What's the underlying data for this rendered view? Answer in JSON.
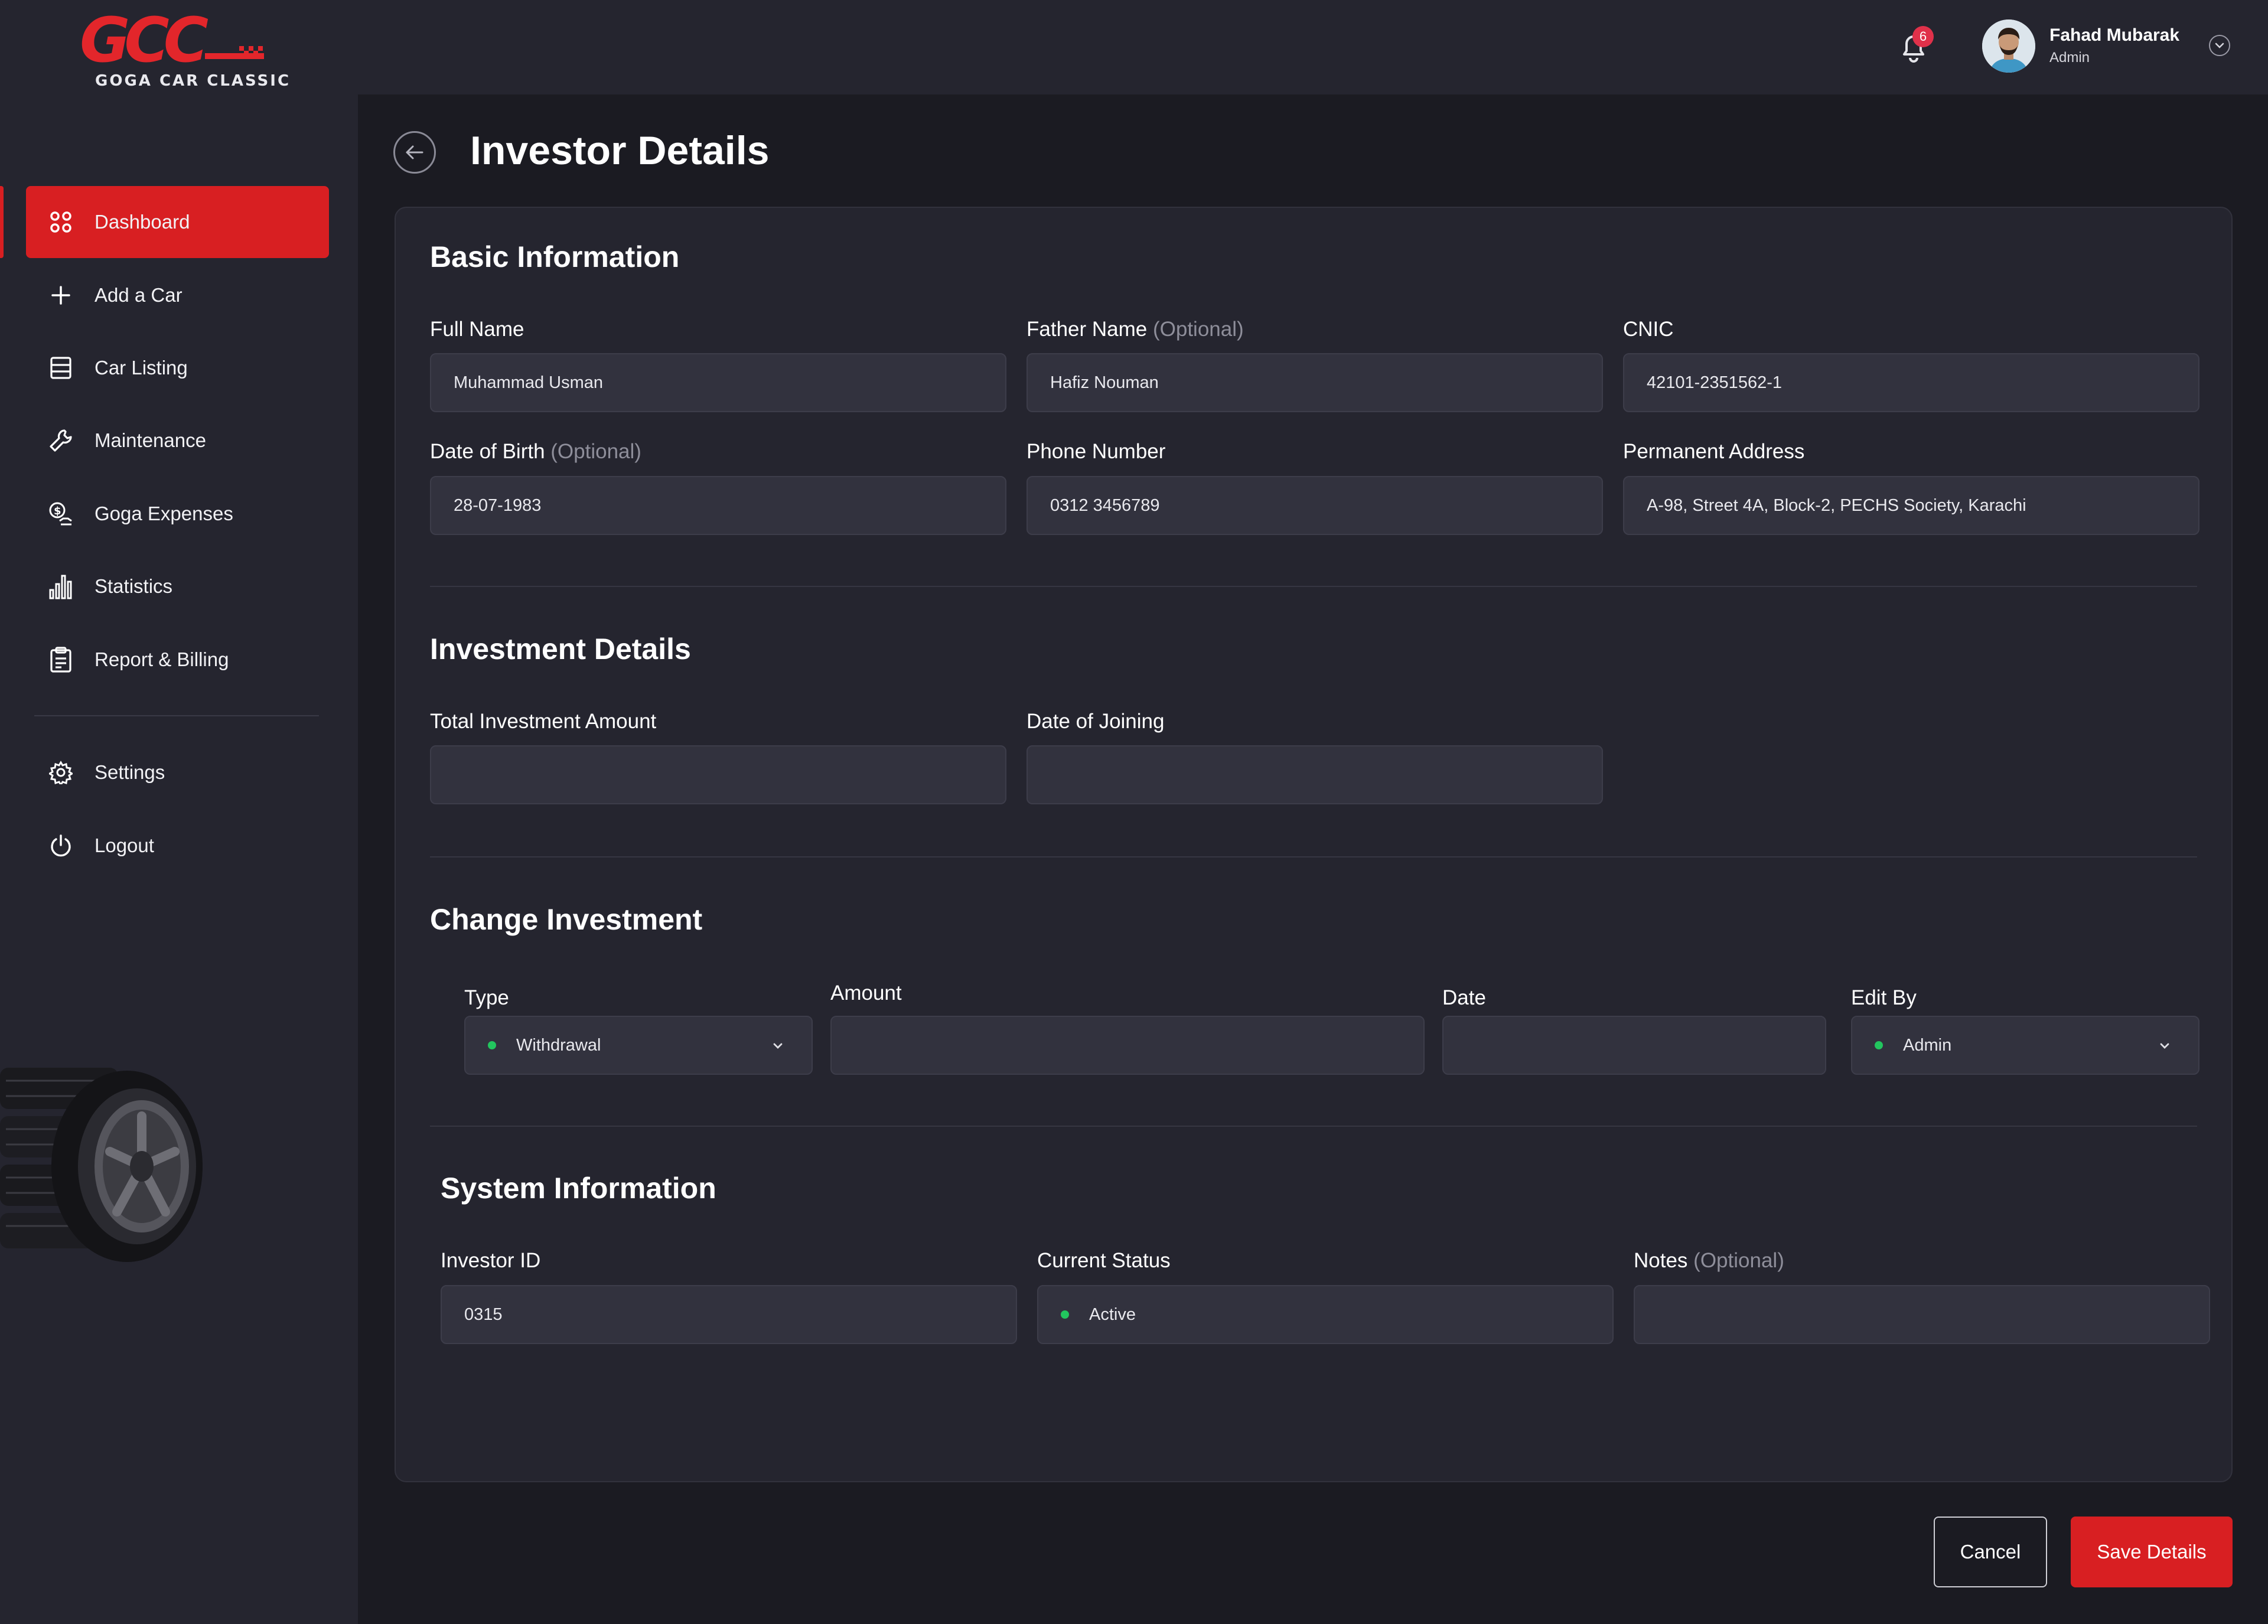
{
  "brand": {
    "logo_text": "GCC",
    "logo_subtitle": "Goga Car Classic",
    "accent_color": "#d81f22"
  },
  "sidebar": {
    "items": [
      {
        "label": "Dashboard",
        "icon": "grid-icon",
        "active": true
      },
      {
        "label": "Add a Car",
        "icon": "plus-icon",
        "active": false
      },
      {
        "label": "Car Listing",
        "icon": "list-icon",
        "active": false
      },
      {
        "label": "Maintenance",
        "icon": "wrench-icon",
        "active": false
      },
      {
        "label": "Goga Expenses",
        "icon": "money-hand-icon",
        "active": false
      },
      {
        "label": "Statistics",
        "icon": "bar-chart-icon",
        "active": false
      },
      {
        "label": "Report & Billing",
        "icon": "clipboard-icon",
        "active": false
      },
      {
        "label": "Settings",
        "icon": "gear-icon",
        "active": false
      },
      {
        "label": "Logout",
        "icon": "power-icon",
        "active": false
      }
    ]
  },
  "header": {
    "notification_count": "6",
    "user_name": "Fahad Mubarak",
    "user_role": "Admin"
  },
  "page": {
    "title": "Investor Details"
  },
  "basic_info": {
    "title": "Basic Information",
    "full_name_label": "Full Name",
    "full_name": "Muhammad Usman",
    "father_name_label": "Father Name",
    "father_name": "Hafiz Nouman",
    "cnic_label": "CNIC",
    "cnic": "42101-2351562-1",
    "dob_label": "Date of Birth",
    "dob": "28-07-1983",
    "phone_label": "Phone Number",
    "phone": "0312 3456789",
    "address_label": "Permanent Address",
    "address": "A-98, Street 4A, Block-2, PECHS Society, Karachi",
    "optional_text": "(Optional)"
  },
  "investment": {
    "title": "Investment Details",
    "total_label": "Total Investment Amount",
    "total_value": "",
    "joining_label": "Date of Joining",
    "joining_value": ""
  },
  "change_investment": {
    "title": "Change Investment",
    "type_label": "Type",
    "type_value": "Withdrawal",
    "amount_label": "Amount",
    "amount_value": "",
    "date_label": "Date",
    "date_value": "",
    "edit_by_label": "Edit By",
    "edit_by_value": "Admin"
  },
  "system_info": {
    "title": "System Information",
    "investor_id_label": "Investor ID",
    "investor_id": "0315",
    "status_label": "Current Status",
    "status": "Active",
    "status_color": "#22c55e",
    "notes_label": "Notes",
    "notes": "",
    "optional_text": "(Optional)"
  },
  "actions": {
    "cancel_label": "Cancel",
    "save_label": "Save Details"
  }
}
